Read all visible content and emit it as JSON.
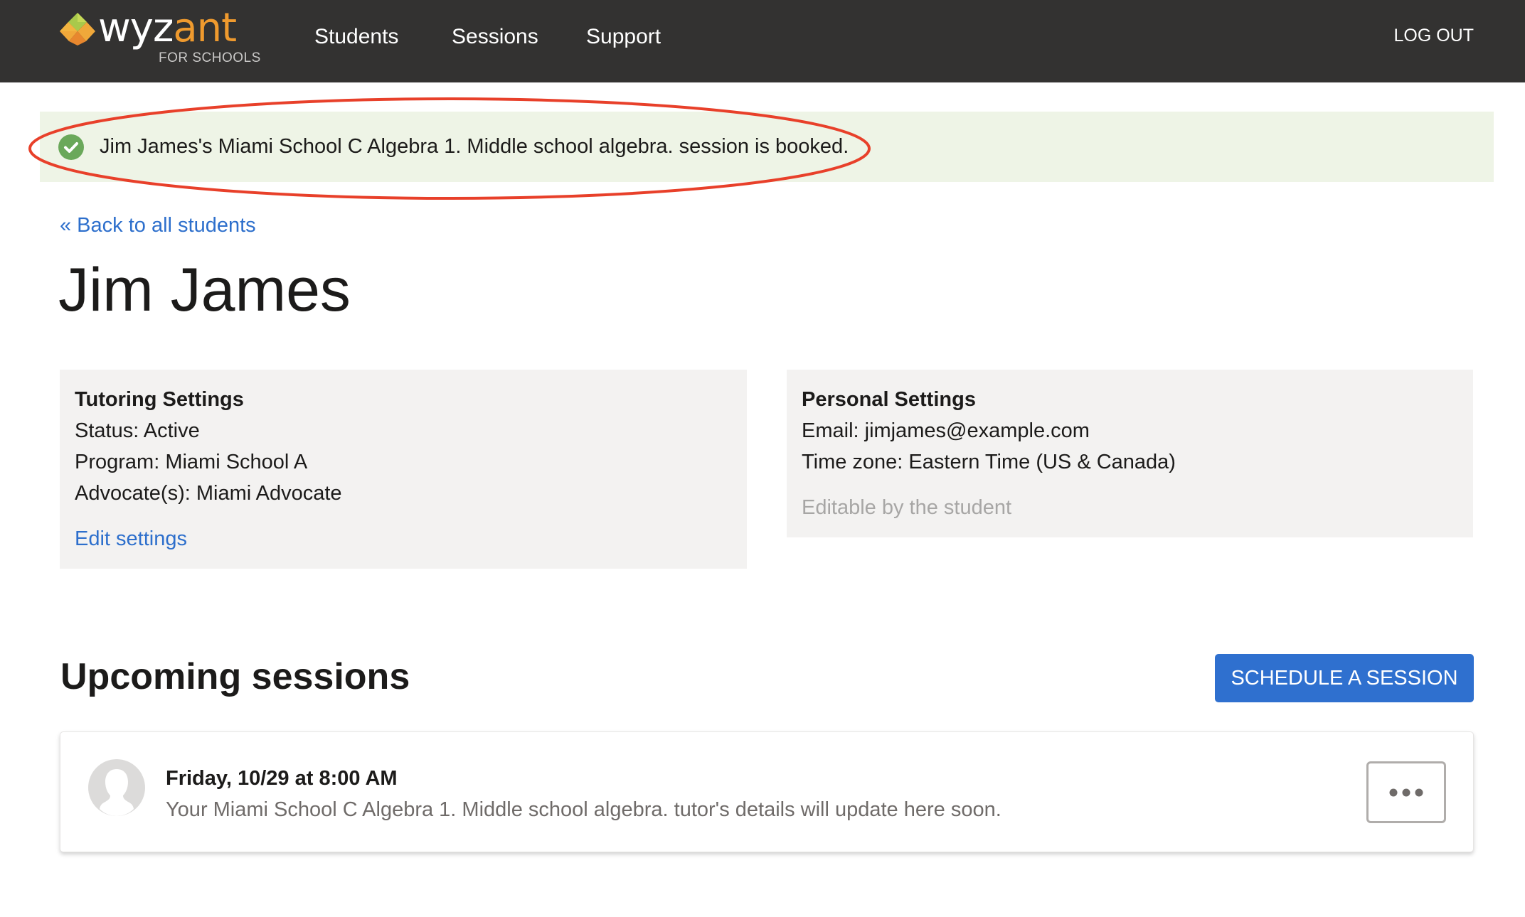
{
  "header": {
    "logo": {
      "brand_part1": "wyz",
      "brand_part2": "ant",
      "subtitle": "FOR SCHOOLS"
    },
    "nav": [
      {
        "label": "Students"
      },
      {
        "label": "Sessions"
      },
      {
        "label": "Support"
      }
    ],
    "logout_label": "LOG OUT"
  },
  "banner": {
    "icon": "check-circle-icon",
    "message": "Jim James's Miami School C Algebra 1. Middle school algebra. session is booked.",
    "annotation": "red-ellipse-highlight"
  },
  "back_link": "« Back to all students",
  "student_name": "Jim James",
  "tutoring_settings": {
    "title": "Tutoring Settings",
    "lines": [
      "Status: Active",
      "Program: Miami School A",
      "Advocate(s): Miami Advocate"
    ],
    "edit_label": "Edit settings"
  },
  "personal_settings": {
    "title": "Personal Settings",
    "lines": [
      "Email: jimjames@example.com",
      "Time zone: Eastern Time (US & Canada)"
    ],
    "note": "Editable by the student"
  },
  "upcoming": {
    "title": "Upcoming sessions",
    "schedule_label": "SCHEDULE A SESSION",
    "sessions": [
      {
        "when": "Friday, 10/29 at 8:00 AM",
        "detail": "Your Miami School C Algebra 1. Middle school algebra. tutor's details will update here soon.",
        "avatar": "default-user-avatar-icon",
        "menu_icon": "more-horizontal-icon"
      }
    ]
  },
  "colors": {
    "header_bg": "#333231",
    "banner_bg": "#eef4e6",
    "success_green": "#6aa85a",
    "link_blue": "#2d6fcc",
    "primary_button": "#2f70cf",
    "panel_bg": "#f3f2f1",
    "annotation_red": "#e8402a",
    "brand_orange": "#ef9a2e"
  }
}
